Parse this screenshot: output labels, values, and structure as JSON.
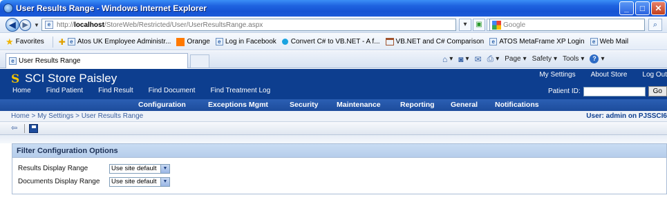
{
  "window": {
    "title": "User Results Range - Windows Internet Explorer",
    "min": "_",
    "max": "□",
    "close": "✕"
  },
  "address": {
    "url_prefix": "http://",
    "url_host": "localhost",
    "url_path": "/StoreWeb/Restricted/User/UserResultsRange.aspx",
    "search_placeholder": "Google"
  },
  "favorites": {
    "label": "Favorites",
    "items": [
      "Atos UK Employee Administr...",
      "Orange",
      "Log in",
      "Facebook",
      "Convert C# to VB.NET - A f...",
      "VB.NET and C# Comparison",
      "ATOS MetaFrame XP Login",
      "Web Mail"
    ]
  },
  "tab": {
    "title": "User Results Range"
  },
  "commands": {
    "page": "Page",
    "safety": "Safety",
    "tools": "Tools"
  },
  "site": {
    "title": "SCI Store Paisley",
    "top_links": [
      "My Settings",
      "About Store",
      "Log Out"
    ],
    "main_nav": [
      "Home",
      "Find Patient",
      "Find Result",
      "Find Document",
      "Find Treatment Log"
    ],
    "patient_id_label": "Patient ID:",
    "go_label": "Go",
    "sub_nav": [
      "Configuration",
      "Exceptions Mgmt",
      "Security",
      "Maintenance",
      "Reporting",
      "General",
      "Notifications"
    ]
  },
  "breadcrumb": {
    "text": "Home > My Settings > User Results Range",
    "user": "User: admin on PJSSCI6"
  },
  "panel": {
    "title": "Filter Configuration Options",
    "rows": [
      {
        "label": "Results Display Range",
        "value": "Use site default"
      },
      {
        "label": "Documents Display Range",
        "value": "Use site default"
      }
    ]
  }
}
